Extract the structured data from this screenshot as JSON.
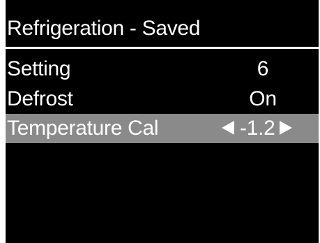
{
  "header": {
    "title": "Refrigeration - Saved"
  },
  "menu": {
    "items": [
      {
        "label": "Setting",
        "value": "6"
      },
      {
        "label": "Defrost",
        "value": "On"
      },
      {
        "label": "Temperature Cal",
        "value": "-1.2",
        "selected": true
      }
    ]
  },
  "colors": {
    "background": "#000000",
    "text": "#ffffff",
    "selection": "#8a8a8a"
  },
  "icons": {
    "decrease": "left-triangle-icon",
    "increase": "right-triangle-icon"
  }
}
